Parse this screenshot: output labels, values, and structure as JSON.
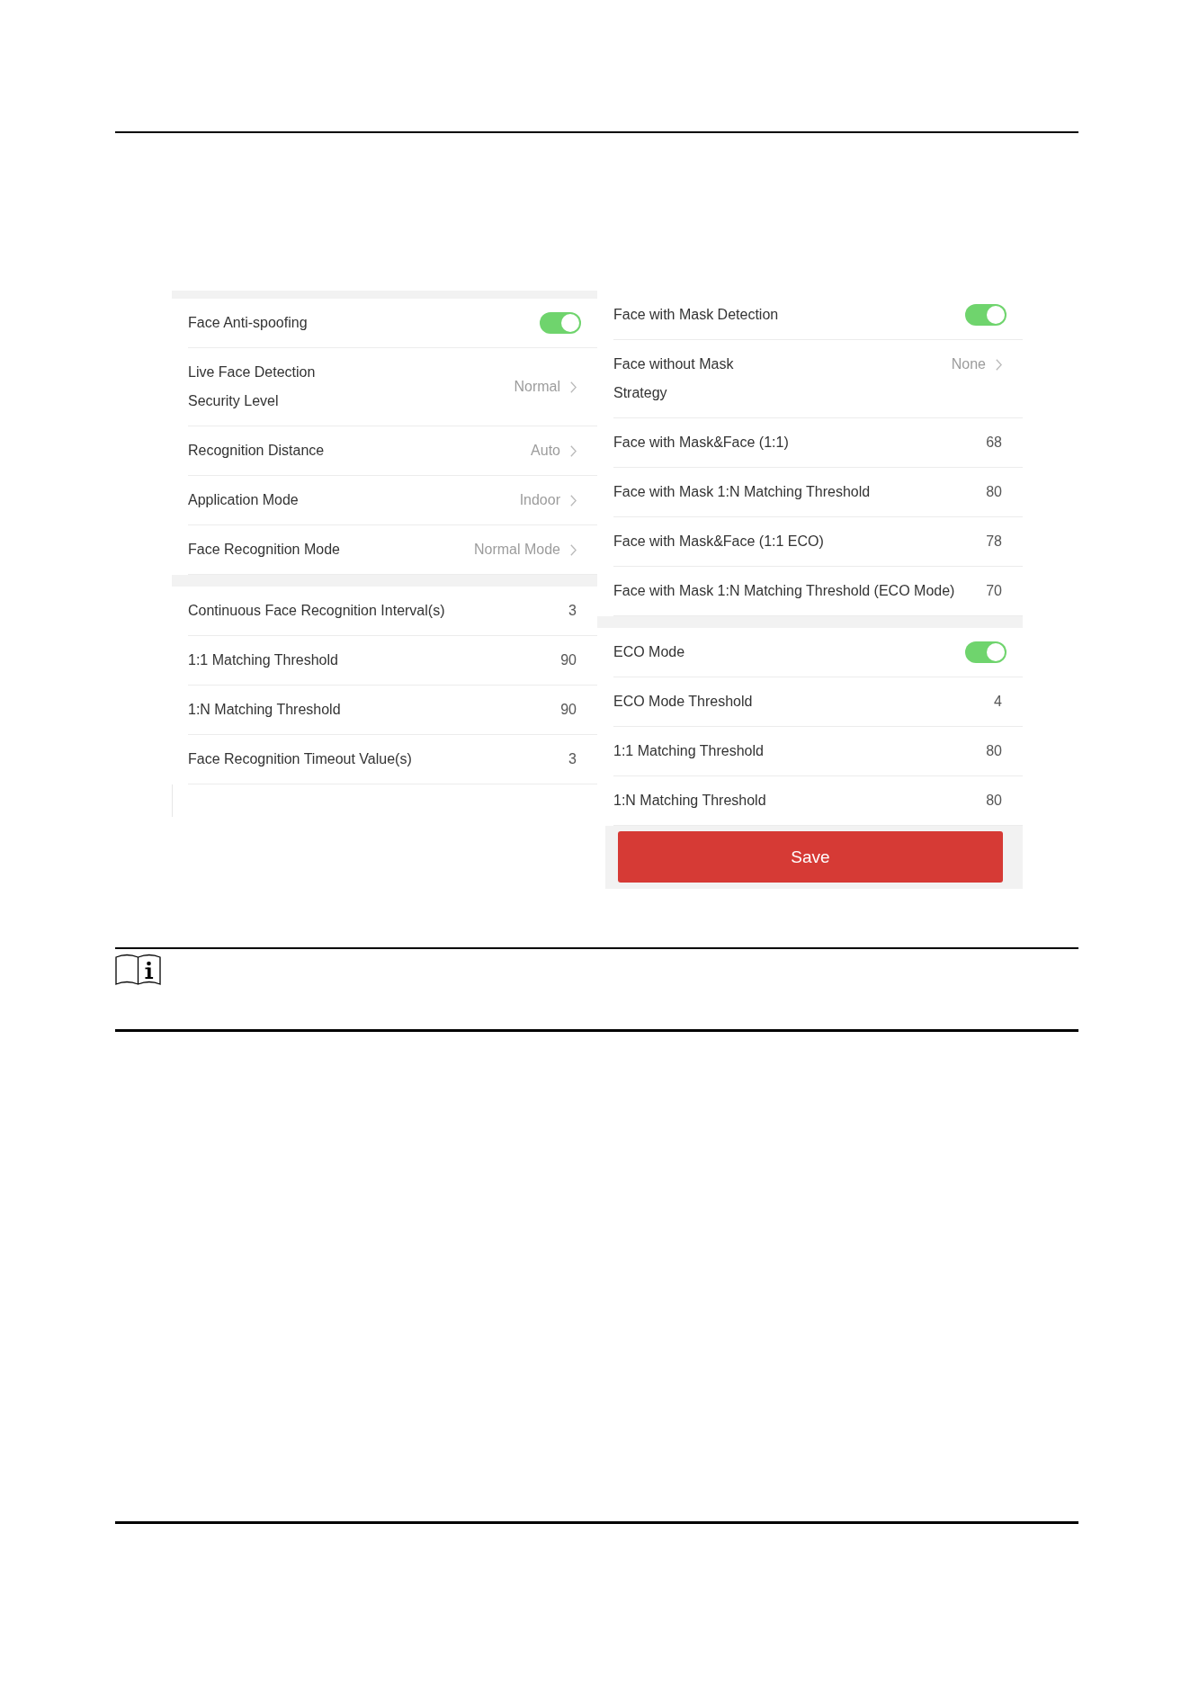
{
  "panels": [
    {
      "groups": [
        {
          "rows": [
            {
              "kind": "toggle",
              "label": "Face Anti-spoofing",
              "on": true
            },
            {
              "kind": "select",
              "label": "Live Face Detection\nSecurity Level",
              "value": "Normal"
            },
            {
              "kind": "select",
              "label": "Recognition Distance",
              "value": "Auto"
            },
            {
              "kind": "select",
              "label": "Application Mode",
              "value": "Indoor"
            },
            {
              "kind": "select",
              "label": "Face Recognition Mode",
              "value": "Normal Mode"
            }
          ]
        },
        {
          "rows": [
            {
              "kind": "number",
              "label": "Continuous Face Recognition Interval(s)",
              "value": "3"
            },
            {
              "kind": "number",
              "label": "1:1 Matching Threshold",
              "value": "90"
            },
            {
              "kind": "number",
              "label": "1:N Matching Threshold",
              "value": "90"
            },
            {
              "kind": "number",
              "label": "Face Recognition Timeout Value(s)",
              "value": "3"
            }
          ]
        }
      ]
    },
    {
      "groups": [
        {
          "rows": [
            {
              "kind": "toggle",
              "label": "Face with Mask Detection",
              "on": true
            },
            {
              "kind": "select",
              "label": "Face without Mask\nStrategy",
              "value": "None"
            },
            {
              "kind": "number",
              "label": "Face with Mask&Face (1:1)",
              "value": "68"
            },
            {
              "kind": "number",
              "label": "Face with Mask 1:N Matching Threshold",
              "value": "80"
            },
            {
              "kind": "number",
              "label": "Face with Mask&Face (1:1 ECO)",
              "value": "78"
            },
            {
              "kind": "number",
              "label": "Face with Mask 1:N Matching Threshold (ECO Mode)",
              "value": "70"
            }
          ]
        },
        {
          "rows": [
            {
              "kind": "toggle",
              "label": "ECO Mode",
              "on": true
            },
            {
              "kind": "number",
              "label": "ECO Mode Threshold",
              "value": "4"
            },
            {
              "kind": "number",
              "label": "1:1 Matching Threshold",
              "value": "80"
            },
            {
              "kind": "number",
              "label": "1:N Matching Threshold",
              "value": "80"
            }
          ]
        }
      ],
      "save_button": "Save"
    }
  ]
}
